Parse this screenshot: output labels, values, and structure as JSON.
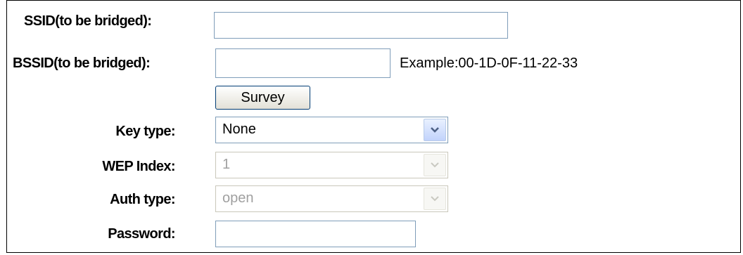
{
  "form": {
    "ssid": {
      "label": "SSID(to be bridged):",
      "value": ""
    },
    "bssid": {
      "label": "BSSID(to be bridged):",
      "value": "",
      "hint": "Example:00-1D-0F-11-22-33"
    },
    "survey_button": "Survey",
    "key_type": {
      "label": "Key type:",
      "selected": "None"
    },
    "wep_index": {
      "label": "WEP Index:",
      "selected": "1",
      "disabled": true
    },
    "auth_type": {
      "label": "Auth type:",
      "selected": "open",
      "disabled": true
    },
    "password": {
      "label": "Password:",
      "value": ""
    }
  },
  "icons": {
    "dropdown": "chevron-down-icon"
  },
  "colors": {
    "input_border": "#7f9db9",
    "arrow_enabled": "#4d6185",
    "arrow_disabled": "#c9c9c1"
  }
}
